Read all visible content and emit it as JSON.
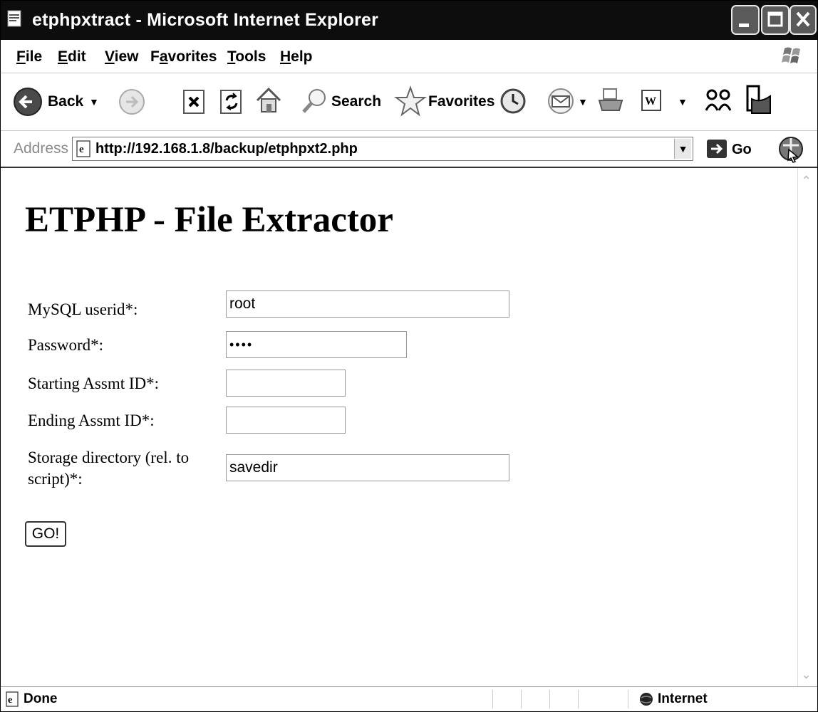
{
  "window": {
    "title": "etphpxtract - Microsoft Internet Explorer"
  },
  "menu": [
    {
      "label": "File",
      "access_key": "F",
      "rest": "ile"
    },
    {
      "label": "Edit",
      "access_key": "E",
      "rest": "dit"
    },
    {
      "label": "View",
      "access_key": "V",
      "rest": "iew"
    },
    {
      "label": "Favorites",
      "pre": "F",
      "access_key": "a",
      "rest": "vorites"
    },
    {
      "label": "Tools",
      "access_key": "T",
      "rest": "ools"
    },
    {
      "label": "Help",
      "access_key": "H",
      "rest": "elp"
    }
  ],
  "toolbar": {
    "back_label": "Back",
    "search_label": "Search",
    "favorites_label": "Favorites"
  },
  "address": {
    "label": "Address",
    "url": "http://192.168.1.8/backup/etphpxt2.php",
    "go_label": "Go"
  },
  "page": {
    "title": "ETPHP - File Extractor",
    "fields": {
      "userid": {
        "label": "MySQL userid*:",
        "value": "root"
      },
      "password": {
        "label": "Password*:",
        "value": "••••"
      },
      "start_id": {
        "label": "Starting Assmt ID*:",
        "value": ""
      },
      "end_id": {
        "label": "Ending Assmt ID*:",
        "value": ""
      },
      "storage": {
        "label_line1": "Storage directory (rel. to",
        "label_line2": "script)*:",
        "value": "savedir"
      }
    },
    "submit_label": "GO!"
  },
  "status": {
    "text": "Done",
    "zone": "Internet"
  }
}
